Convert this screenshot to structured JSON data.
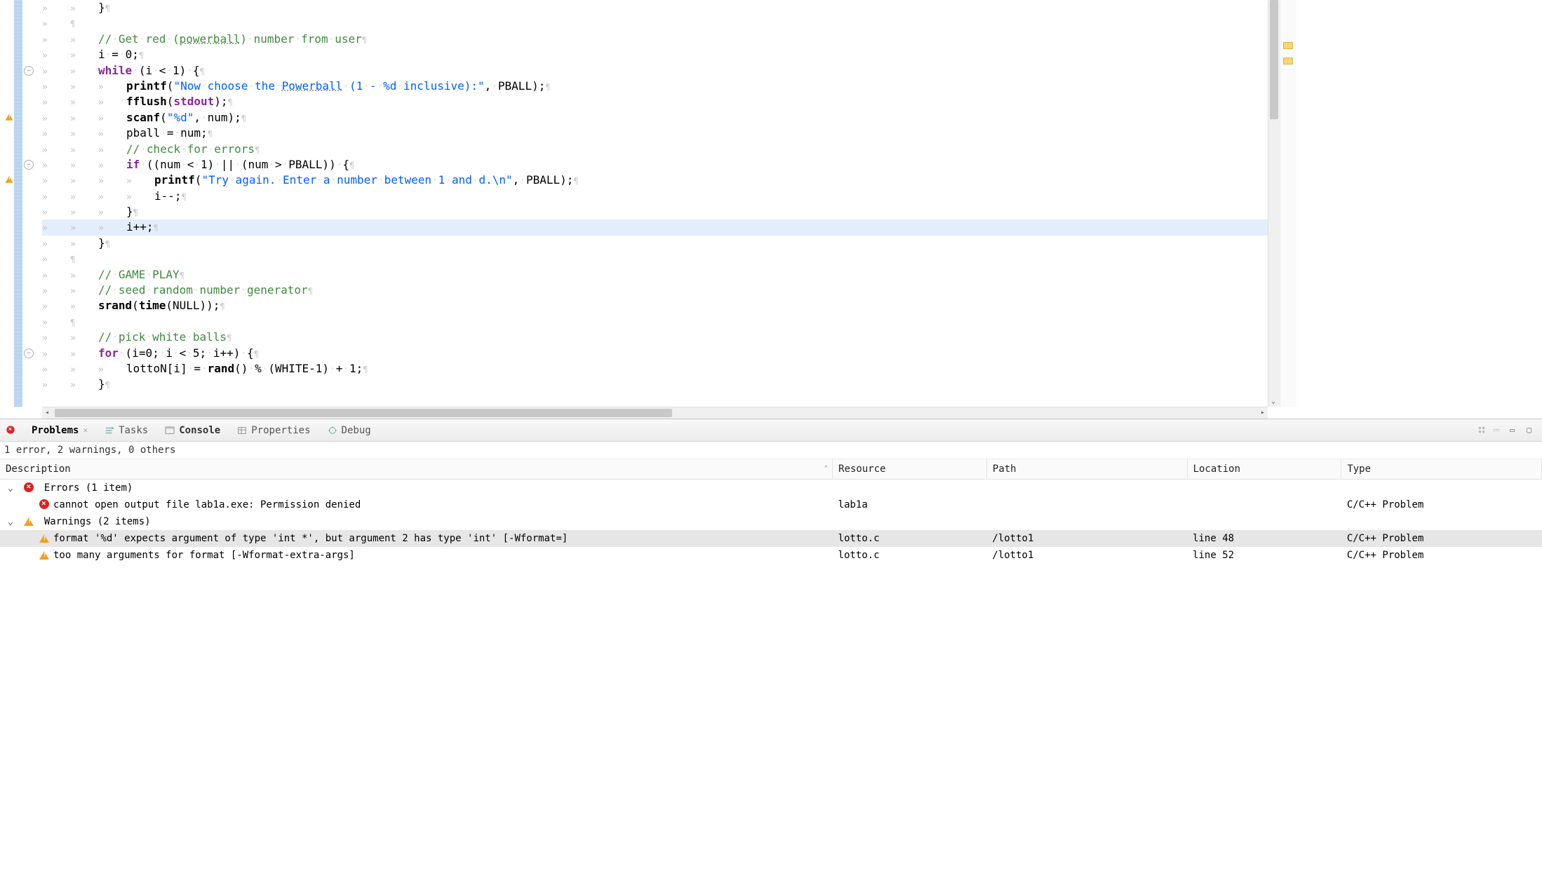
{
  "editor": {
    "highlighted_line_index": 14,
    "fold_markers": [
      4,
      10,
      22
    ],
    "gutter_warnings": [
      7,
      11
    ],
    "overview_markers": [
      60,
      82
    ],
    "lines": [
      {
        "indent": 1,
        "tokens": [
          {
            "t": "}",
            "c": ""
          }
        ]
      },
      {
        "indent": 0,
        "tokens": [
          {
            "t": "",
            "c": ""
          }
        ]
      },
      {
        "indent": 1,
        "tokens": [
          {
            "t": "// Get red (",
            "c": "cmt"
          },
          {
            "t": "powerball",
            "c": "cmt underline"
          },
          {
            "t": ") number from user",
            "c": "cmt"
          }
        ]
      },
      {
        "indent": 1,
        "tokens": [
          {
            "t": "i = 0;",
            "c": ""
          }
        ]
      },
      {
        "indent": 1,
        "tokens": [
          {
            "t": "while",
            "c": "kw"
          },
          {
            "t": " (i < 1) {",
            "c": ""
          }
        ]
      },
      {
        "indent": 2,
        "tokens": [
          {
            "t": "printf",
            "c": "fn"
          },
          {
            "t": "(",
            "c": ""
          },
          {
            "t": "\"Now choose the ",
            "c": "str"
          },
          {
            "t": "Powerball",
            "c": "str underline"
          },
          {
            "t": " (1 - %d inclusive):\"",
            "c": "str"
          },
          {
            "t": ", PBALL);",
            "c": ""
          }
        ]
      },
      {
        "indent": 2,
        "tokens": [
          {
            "t": "fflush",
            "c": "fn"
          },
          {
            "t": "(",
            "c": ""
          },
          {
            "t": "stdout",
            "c": "kw"
          },
          {
            "t": ");",
            "c": ""
          }
        ]
      },
      {
        "indent": 2,
        "tokens": [
          {
            "t": "scanf",
            "c": "fn"
          },
          {
            "t": "(",
            "c": ""
          },
          {
            "t": "\"%d\"",
            "c": "str"
          },
          {
            "t": ", num);",
            "c": ""
          }
        ]
      },
      {
        "indent": 2,
        "tokens": [
          {
            "t": "pball = num;",
            "c": ""
          }
        ]
      },
      {
        "indent": 2,
        "tokens": [
          {
            "t": "// check for errors",
            "c": "cmt"
          }
        ]
      },
      {
        "indent": 2,
        "tokens": [
          {
            "t": "if",
            "c": "kw"
          },
          {
            "t": " ((num < 1) || (num > PBALL)) {",
            "c": ""
          }
        ]
      },
      {
        "indent": 3,
        "tokens": [
          {
            "t": "printf",
            "c": "fn"
          },
          {
            "t": "(",
            "c": ""
          },
          {
            "t": "\"Try again. Enter a number between 1 and d.\\n\"",
            "c": "str"
          },
          {
            "t": ", PBALL);",
            "c": ""
          }
        ]
      },
      {
        "indent": 3,
        "tokens": [
          {
            "t": "i--;",
            "c": ""
          }
        ]
      },
      {
        "indent": 2,
        "tokens": [
          {
            "t": "}",
            "c": ""
          }
        ]
      },
      {
        "indent": 2,
        "tokens": [
          {
            "t": "i++;",
            "c": ""
          }
        ]
      },
      {
        "indent": 1,
        "tokens": [
          {
            "t": "}",
            "c": ""
          }
        ]
      },
      {
        "indent": 0,
        "tokens": [
          {
            "t": "",
            "c": ""
          }
        ]
      },
      {
        "indent": 1,
        "tokens": [
          {
            "t": "// GAME PLAY",
            "c": "cmt"
          }
        ]
      },
      {
        "indent": 1,
        "tokens": [
          {
            "t": "// seed random number generator",
            "c": "cmt"
          }
        ]
      },
      {
        "indent": 1,
        "tokens": [
          {
            "t": "srand",
            "c": "fn"
          },
          {
            "t": "(",
            "c": ""
          },
          {
            "t": "time",
            "c": "fn"
          },
          {
            "t": "(NULL));",
            "c": ""
          }
        ]
      },
      {
        "indent": 0,
        "tokens": [
          {
            "t": "",
            "c": ""
          }
        ]
      },
      {
        "indent": 1,
        "tokens": [
          {
            "t": "// pick white balls",
            "c": "cmt"
          }
        ]
      },
      {
        "indent": 1,
        "tokens": [
          {
            "t": "for",
            "c": "kw"
          },
          {
            "t": " (i=0; i < 5; i++) {",
            "c": ""
          }
        ]
      },
      {
        "indent": 2,
        "tokens": [
          {
            "t": "lottoN[i] = ",
            "c": ""
          },
          {
            "t": "rand",
            "c": "fn"
          },
          {
            "t": "() % (WHITE-1) + 1;",
            "c": ""
          }
        ]
      },
      {
        "indent": 1,
        "tokens": [
          {
            "t": "}",
            "c": ""
          }
        ]
      }
    ]
  },
  "panel": {
    "tabs": {
      "problems": "Problems",
      "tasks": "Tasks",
      "console": "Console",
      "properties": "Properties",
      "debug": "Debug"
    },
    "summary": "1 error, 2 warnings, 0 others",
    "columns": {
      "description": "Description",
      "resource": "Resource",
      "path": "Path",
      "location": "Location",
      "type": "Type"
    },
    "groups": {
      "errors_label": "Errors (1 item)",
      "warnings_label": "Warnings (2 items)"
    },
    "rows": {
      "err1": {
        "desc": "cannot open output file lab1a.exe: Permission denied",
        "resource": "lab1a",
        "path": "",
        "location": "",
        "type": "C/C++ Problem"
      },
      "warn1": {
        "desc": "format '%d' expects argument of type 'int *', but argument 2 has type 'int' [-Wformat=]",
        "resource": "lotto.c",
        "path": "/lotto1",
        "location": "line 48",
        "type": "C/C++ Problem"
      },
      "warn2": {
        "desc": "too many arguments for format [-Wformat-extra-args]",
        "resource": "lotto.c",
        "path": "/lotto1",
        "location": "line 52",
        "type": "C/C++ Problem"
      }
    }
  }
}
